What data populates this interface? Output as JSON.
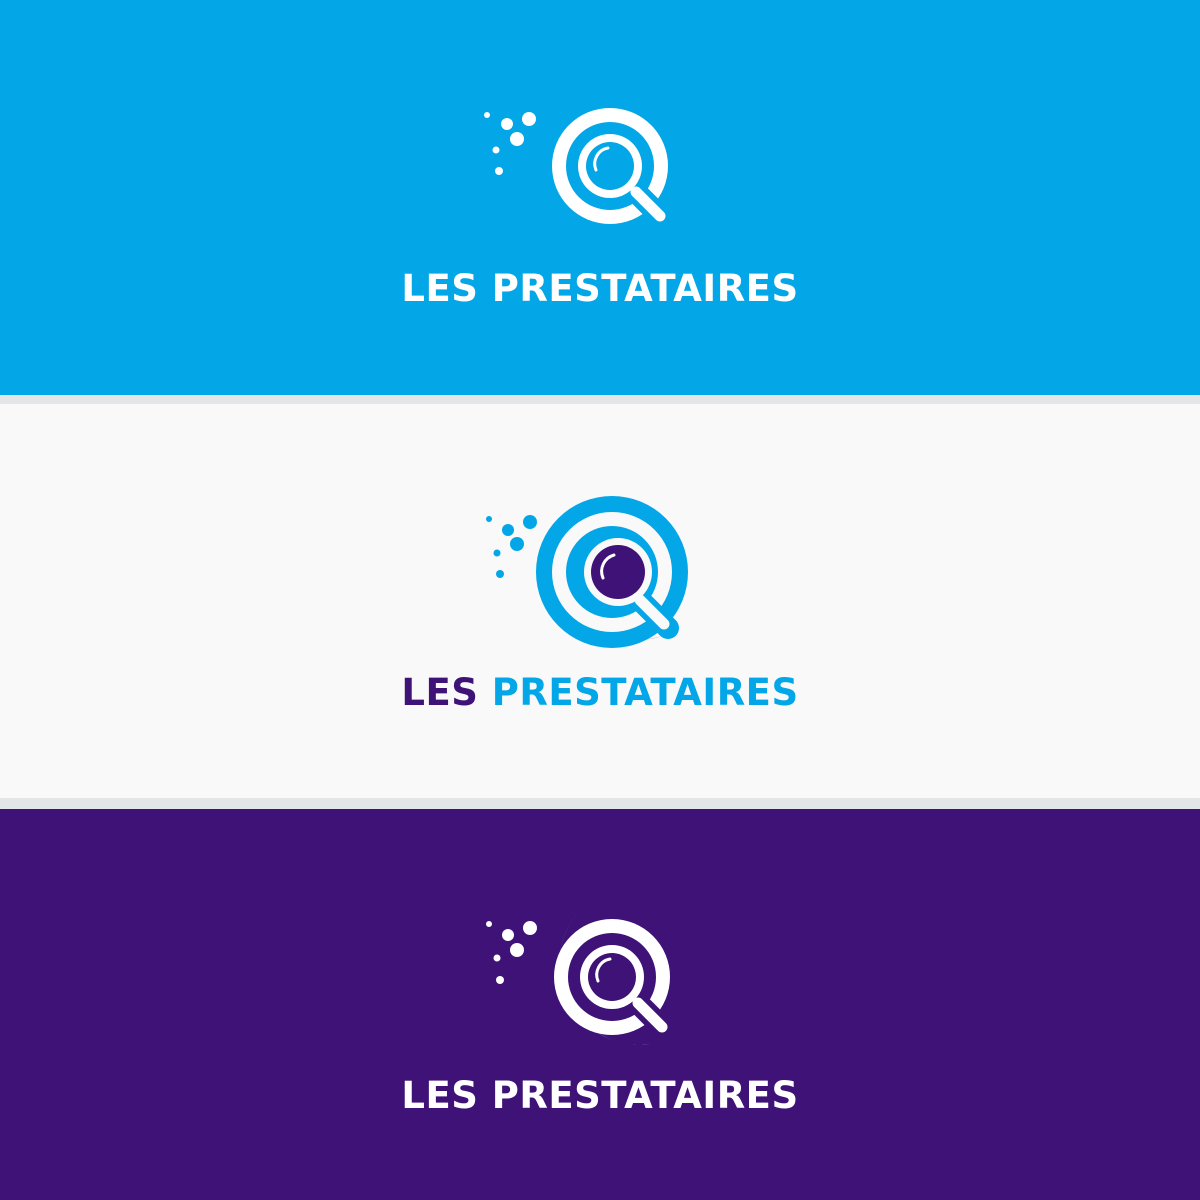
{
  "colors": {
    "blue": "#03a6e6",
    "purple": "#3e1276",
    "light_bg": "#f9f9f9",
    "separator": "#e4e5e7",
    "white": "#ffffff"
  },
  "icon_name": "magnifier-crescent-logo-icon",
  "panels": [
    {
      "id": "blue",
      "background": "#03a6e6",
      "word_les": "LES",
      "word_prestataires": "PRESTATAIRES"
    },
    {
      "id": "light",
      "background": "#f9f9f9",
      "word_les": "LES",
      "word_prestataires": "PRESTATAIRES"
    },
    {
      "id": "purple",
      "background": "#3e1276",
      "word_les": "LES",
      "word_prestataires": "PRESTATAIRES"
    }
  ]
}
